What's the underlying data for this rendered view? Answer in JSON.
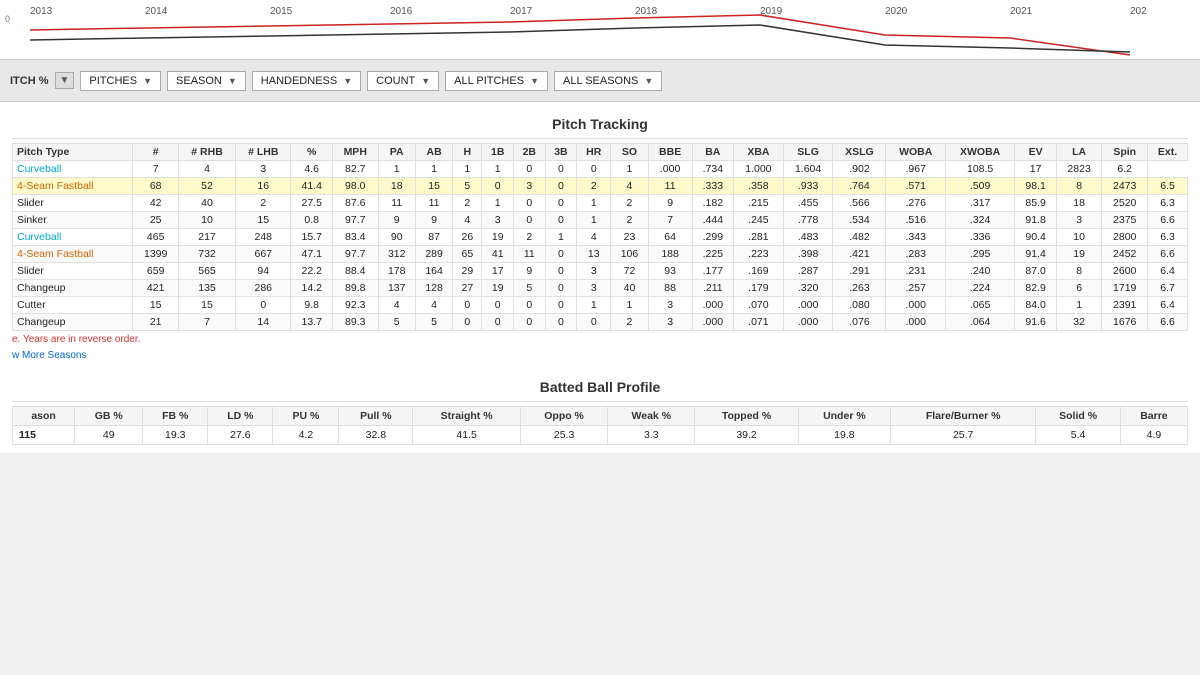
{
  "chart": {
    "years": [
      "2013",
      "2014",
      "2015",
      "2016",
      "2017",
      "2018",
      "2019",
      "2020",
      "2021",
      "202"
    ]
  },
  "filters": {
    "pitch_pct_label": "ITCH %",
    "pitches_label": "PITCHES",
    "season_label": "SEASON",
    "handedness_label": "HANDEDNESS",
    "count_label": "COUNT",
    "all_pitches_label": "ALL PITCHES",
    "all_seasons_label": "ALL SEASONS"
  },
  "pitch_tracking": {
    "title": "Pitch Tracking",
    "headers": [
      "Pitch Type",
      "#",
      "# RHB",
      "# LHB",
      "%",
      "MPH",
      "PA",
      "AB",
      "H",
      "1B",
      "2B",
      "3B",
      "HR",
      "SO",
      "BBE",
      "BA",
      "XBA",
      "SLG",
      "XSLG",
      "WOBA",
      "XWOBA",
      "EV",
      "LA",
      "Spin",
      "Ext."
    ],
    "rows": [
      {
        "type": "Curveball",
        "color": "cyan",
        "highlighted": false,
        "values": [
          "7",
          "4",
          "3",
          "4.6",
          "82.7",
          "1",
          "1",
          "1",
          "1",
          "0",
          "0",
          "0",
          "1",
          ".000",
          ".734",
          "1.000",
          "1.604",
          ".902",
          ".967",
          "108.5",
          "17",
          "2823",
          "6.2"
        ]
      },
      {
        "type": "4-Seam Fastball",
        "color": "orange",
        "highlighted": true,
        "values": [
          "68",
          "52",
          "16",
          "41.4",
          "98.0",
          "18",
          "15",
          "5",
          "0",
          "3",
          "0",
          "2",
          "4",
          "11",
          ".333",
          ".358",
          ".933",
          ".764",
          ".571",
          ".509",
          "98.1",
          "8",
          "2473",
          "6.5"
        ]
      },
      {
        "type": "Slider",
        "color": "none",
        "highlighted": false,
        "values": [
          "42",
          "40",
          "2",
          "27.5",
          "87.6",
          "11",
          "11",
          "2",
          "1",
          "0",
          "0",
          "1",
          "2",
          "9",
          ".182",
          ".215",
          ".455",
          ".566",
          ".276",
          ".317",
          "85.9",
          "18",
          "2520",
          "6.3"
        ]
      },
      {
        "type": "Sinker",
        "color": "none",
        "highlighted": false,
        "values": [
          "25",
          "10",
          "15",
          "0.8",
          "97.7",
          "9",
          "9",
          "4",
          "3",
          "0",
          "0",
          "1",
          "2",
          "7",
          ".444",
          ".245",
          ".778",
          ".534",
          ".516",
          ".324",
          "91.8",
          "3",
          "2375",
          "6.6"
        ]
      },
      {
        "type": "Curveball",
        "color": "cyan",
        "highlighted": false,
        "values": [
          "465",
          "217",
          "248",
          "15.7",
          "83.4",
          "90",
          "87",
          "26",
          "19",
          "2",
          "1",
          "4",
          "23",
          "64",
          ".299",
          ".281",
          ".483",
          ".482",
          ".343",
          ".336",
          "90.4",
          "10",
          "2800",
          "6.3"
        ]
      },
      {
        "type": "4-Seam Fastball",
        "color": "orange",
        "highlighted": false,
        "values": [
          "1399",
          "732",
          "667",
          "47.1",
          "97.7",
          "312",
          "289",
          "65",
          "41",
          "11",
          "0",
          "13",
          "106",
          "188",
          ".225",
          ".223",
          ".398",
          ".421",
          ".283",
          ".295",
          "91.4",
          "19",
          "2452",
          "6.6"
        ]
      },
      {
        "type": "Slider",
        "color": "none",
        "highlighted": false,
        "values": [
          "659",
          "565",
          "94",
          "22.2",
          "88.4",
          "178",
          "164",
          "29",
          "17",
          "9",
          "0",
          "3",
          "72",
          "93",
          ".177",
          ".169",
          ".287",
          ".291",
          ".231",
          ".240",
          "87.0",
          "8",
          "2600",
          "6.4"
        ]
      },
      {
        "type": "Changeup",
        "color": "none",
        "highlighted": false,
        "values": [
          "421",
          "135",
          "286",
          "14.2",
          "89.8",
          "137",
          "128",
          "27",
          "19",
          "5",
          "0",
          "3",
          "40",
          "88",
          ".211",
          ".179",
          ".320",
          ".263",
          ".257",
          ".224",
          "82.9",
          "6",
          "1719",
          "6.7"
        ]
      },
      {
        "type": "Cutter",
        "color": "none",
        "highlighted": false,
        "values": [
          "15",
          "15",
          "0",
          "9.8",
          "92.3",
          "4",
          "4",
          "0",
          "0",
          "0",
          "0",
          "1",
          "1",
          "3",
          ".000",
          ".070",
          ".000",
          ".080",
          ".000",
          ".065",
          "84.0",
          "1",
          "2391",
          "6.4"
        ]
      },
      {
        "type": "Changeup",
        "color": "none",
        "highlighted": false,
        "values": [
          "21",
          "7",
          "14",
          "13.7",
          "89.3",
          "5",
          "5",
          "0",
          "0",
          "0",
          "0",
          "0",
          "2",
          "3",
          ".000",
          ".071",
          ".000",
          ".076",
          ".000",
          ".064",
          "91.6",
          "32",
          "1676",
          "6.6"
        ]
      }
    ],
    "note": "e. Years are in reverse order.",
    "show_more": "w More Seasons"
  },
  "batted_ball": {
    "title": "Batted Ball Profile",
    "headers": [
      "ason",
      "GB %",
      "FB %",
      "LD %",
      "PU %",
      "Pull %",
      "Straight %",
      "Oppo %",
      "Weak %",
      "Topped %",
      "Under %",
      "Flare/Burner %",
      "Solid %",
      "Barre"
    ],
    "rows": [
      {
        "season": "115",
        "values": [
          "49",
          "19.3",
          "27.6",
          "4.2",
          "32.8",
          "41.5",
          "25.3",
          "3.3",
          "39.2",
          "19.8",
          "25.7",
          "5.4",
          "4.9"
        ]
      }
    ]
  }
}
